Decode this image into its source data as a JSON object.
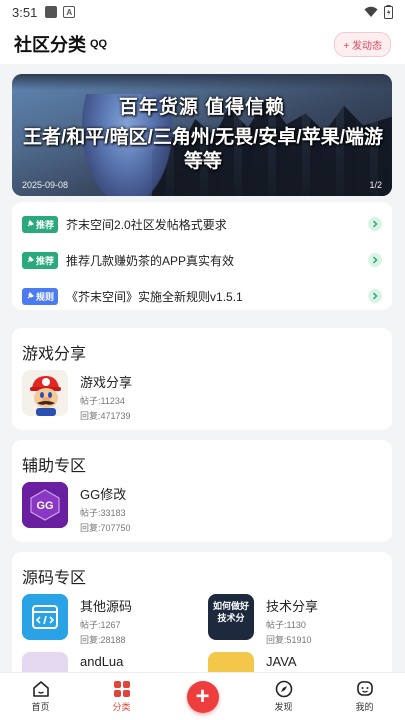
{
  "status_bar": {
    "time": "3:51"
  },
  "header": {
    "title": "社区分类",
    "qq_badge": "QQ",
    "post_button": "+ 发动态"
  },
  "banner": {
    "line1": "百年货源  值得信赖",
    "line2": "王者/和平/暗区/三角州/无畏/安卓/苹果/端游等等",
    "date": "2025-09-08",
    "pager": "1/2"
  },
  "notices": [
    {
      "tag": "推荐",
      "tag_color": "#2aa97c",
      "text": "芥末空间2.0社区发帖格式要求"
    },
    {
      "tag": "推荐",
      "tag_color": "#2aa97c",
      "text": "推荐几款赚奶茶的APP真实有效"
    },
    {
      "tag": "规则",
      "tag_color": "#4b7bf0",
      "text": "《芥末空间》实施全新规则v1.5.1"
    }
  ],
  "sections": {
    "game_share": {
      "title": "游戏分享",
      "forums": [
        {
          "name": "游戏分享",
          "posts": "帖子:11234",
          "replies": "回复:471739",
          "icon": "mario-icon"
        }
      ]
    },
    "assist": {
      "title": "辅助专区",
      "forums": [
        {
          "name": "GG修改",
          "posts": "帖子:33183",
          "replies": "回复:707750",
          "icon": "gg-icon",
          "logo_text": "GG"
        }
      ]
    },
    "source": {
      "title": "源码专区",
      "forums": [
        {
          "name": "其他源码",
          "posts": "帖子:1267",
          "replies": "回复:28188",
          "icon": "code-window-icon"
        },
        {
          "name": "技术分享",
          "posts": "帖子:1130",
          "replies": "回复:51910",
          "icon": "tech-share-icon",
          "logo_text": "如何做好技术分"
        },
        {
          "name": "andLua",
          "icon": "andlua-icon"
        },
        {
          "name": "JAVA",
          "icon": "java-icon"
        }
      ]
    }
  },
  "bottom_nav": {
    "home": "首页",
    "category": "分类",
    "discover": "发现",
    "mine": "我的"
  },
  "colors": {
    "accent": "#e0443a",
    "green_tag": "#2aa97c",
    "blue_tag": "#4b7bf0"
  }
}
